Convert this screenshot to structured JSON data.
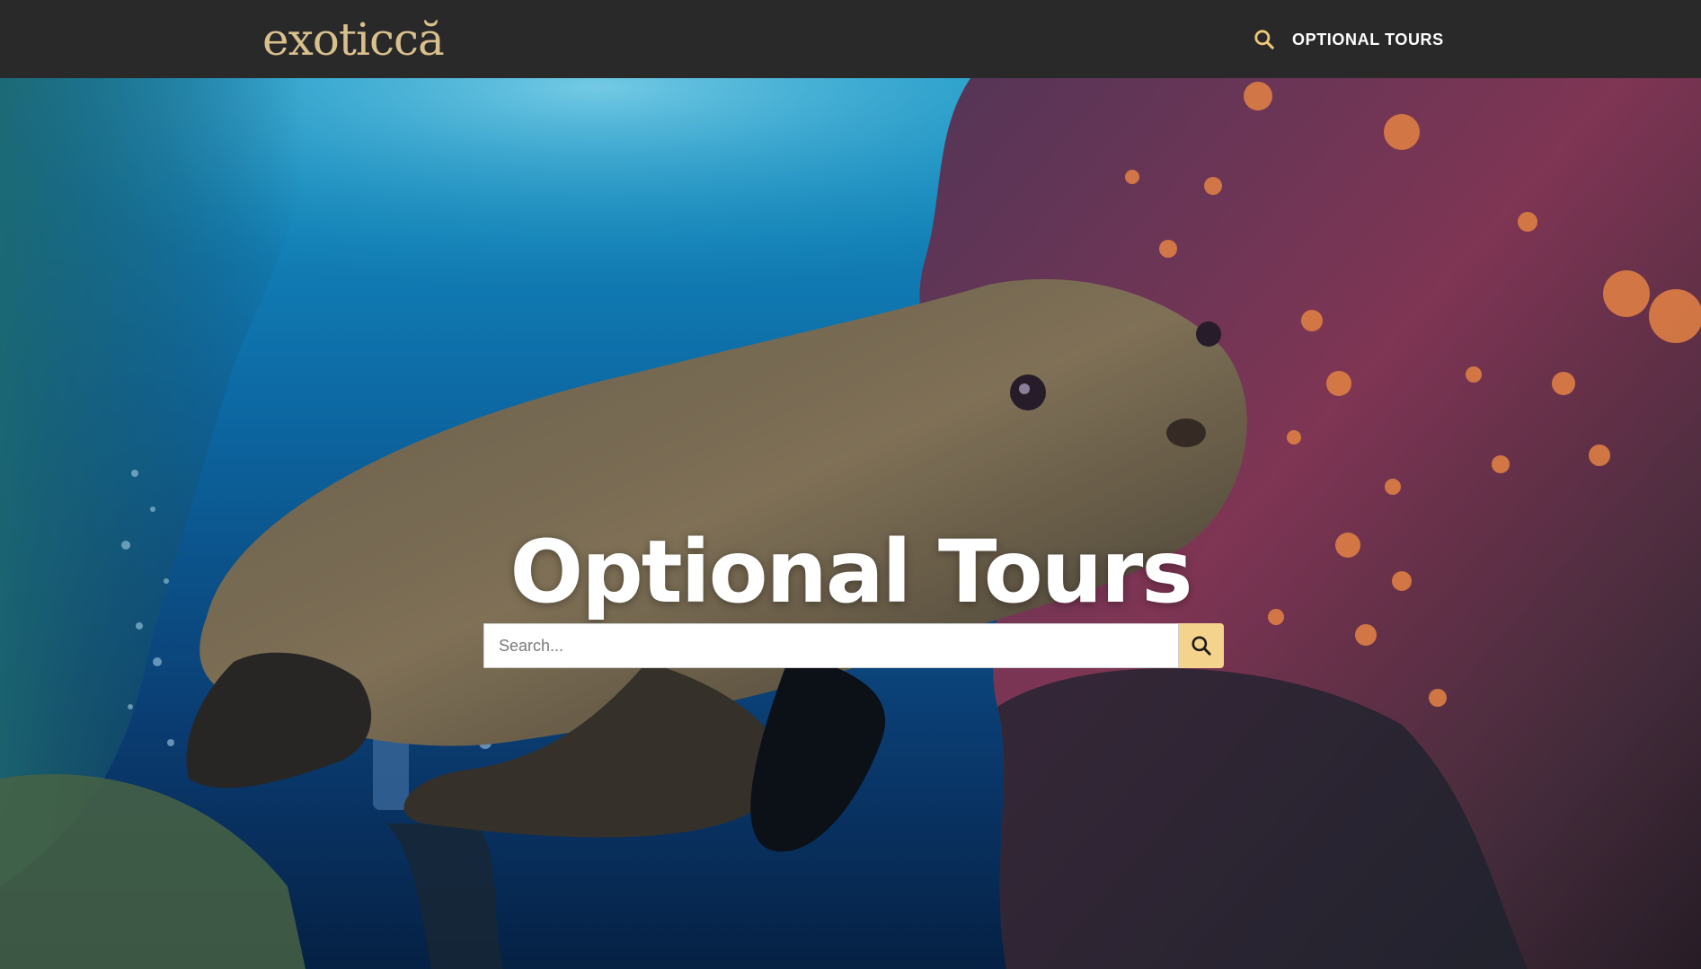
{
  "header": {
    "logo_text": "exoticcă",
    "nav": {
      "search_icon": "search-icon",
      "link_label": "OPTIONAL TOURS"
    }
  },
  "hero": {
    "title": "Optional Tours",
    "background": "underwater-sea-lion-photo",
    "search": {
      "placeholder": "Search...",
      "value": "",
      "button_icon": "search-icon"
    }
  },
  "colors": {
    "header_bg": "#292929",
    "logo": "#d9bf8c",
    "accent": "#f4d38c",
    "nav_icon": "#f0c978"
  }
}
